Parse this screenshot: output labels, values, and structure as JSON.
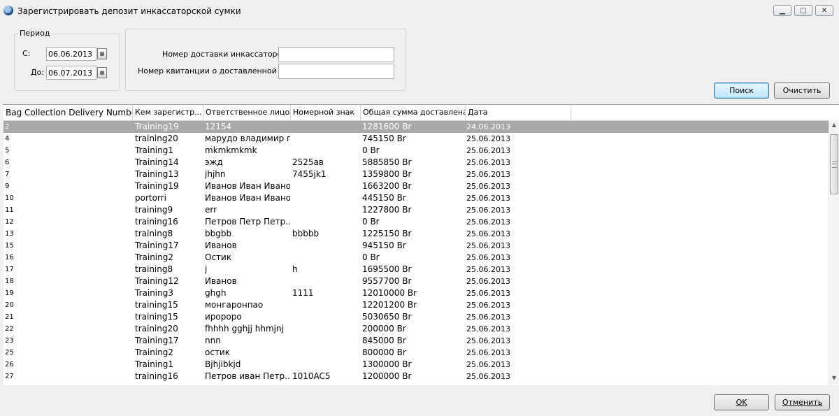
{
  "window": {
    "title": "Зарегистрировать депозит инкассаторской сумки",
    "controls": {
      "minimize": "▁",
      "maximize": "□",
      "close": "✕"
    }
  },
  "period": {
    "legend": "Период",
    "from_label": "С:",
    "from_value": "06.06.2013",
    "to_label": "До:",
    "to_value": "06.07.2013"
  },
  "search": {
    "delivery_number_label": "Номер доставки инкассаторской",
    "delivery_number_value": "",
    "receipt_number_label": "Номер квитанции о доставленной инкас",
    "receipt_number_value": ""
  },
  "buttons": {
    "search": "Поиск",
    "clear": "Очистить",
    "ok": "OK",
    "cancel": "Отменить"
  },
  "table": {
    "columns": [
      "Bag Collection Delivery Number",
      "Кем зарегистр...",
      "Ответственное лицо",
      "Номерной знак",
      "Общая сумма доставлена",
      "Дата"
    ],
    "rows": [
      [
        "2",
        "Training19",
        "12154",
        "",
        "1281600 Br",
        "24.06.2013"
      ],
      [
        "4",
        "training20",
        "марудо владимир г...",
        "",
        "745150 Br",
        "25.06.2013"
      ],
      [
        "5",
        "Training1",
        "mkmkmkmk",
        "",
        "0 Br",
        "25.06.2013"
      ],
      [
        "6",
        "Training14",
        "эжд",
        "2525ав",
        "5885850 Br",
        "25.06.2013"
      ],
      [
        "7",
        "Training13",
        "jhjhn",
        "7455jk1",
        "1359800 Br",
        "25.06.2013"
      ],
      [
        "9",
        "Training19",
        "Иванов Иван Ивано...",
        "",
        "1663200 Br",
        "25.06.2013"
      ],
      [
        "10",
        "portorri",
        "Иванов Иван Ивано...",
        "",
        "445150 Br",
        "25.06.2013"
      ],
      [
        "11",
        "training9",
        "err",
        "",
        "1227800 Br",
        "25.06.2013"
      ],
      [
        "12",
        "training16",
        "Петров Петр Петр...",
        "",
        "0 Br",
        "25.06.2013"
      ],
      [
        "13",
        "training8",
        "bbgbb",
        "bbbbb",
        "1225150 Br",
        "25.06.2013"
      ],
      [
        "15",
        "Training17",
        "Иванов",
        "",
        "945150 Br",
        "25.06.2013"
      ],
      [
        "16",
        "Training2",
        "Остик",
        "",
        "0 Br",
        "25.06.2013"
      ],
      [
        "17",
        "training8",
        "j",
        "h",
        "1695500 Br",
        "25.06.2013"
      ],
      [
        "18",
        "Training12",
        "Иванов",
        "",
        "9557700 Br",
        "25.06.2013"
      ],
      [
        "19",
        "Training3",
        "ghgh",
        "1111",
        "12010000 Br",
        "25.06.2013"
      ],
      [
        "20",
        "training15",
        "монгаронпао",
        "",
        "12201200 Br",
        "25.06.2013"
      ],
      [
        "21",
        "training15",
        "иророро",
        "",
        "5030650 Br",
        "25.06.2013"
      ],
      [
        "22",
        "training20",
        "fhhhh gghjj hhmjnj",
        "",
        "200000 Br",
        "25.06.2013"
      ],
      [
        "23",
        "Training17",
        "nnn",
        "",
        "845000 Br",
        "25.06.2013"
      ],
      [
        "25",
        "Training2",
        "остик",
        "",
        "800000 Br",
        "25.06.2013"
      ],
      [
        "26",
        "Training1",
        "Bjhjibkjd",
        "",
        "1300000 Br",
        "25.06.2013"
      ],
      [
        "27",
        "training16",
        "Петров иван Петр...",
        "1010AC5",
        "1200000 Br",
        "25.06.2013"
      ]
    ],
    "selected_row": 0
  },
  "icons": {
    "app": "app-globe-icon",
    "calendar": "calendar-icon",
    "scroll_up": "scroll-up-arrow-icon",
    "scroll_down": "scroll-down-arrow-icon"
  }
}
